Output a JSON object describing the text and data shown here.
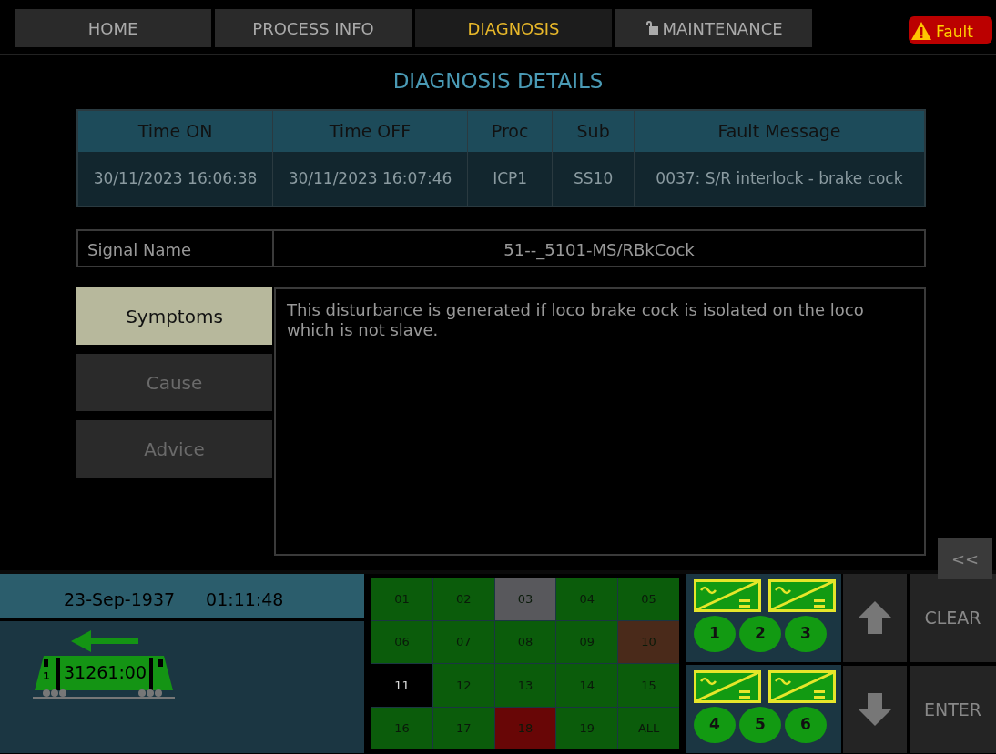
{
  "tabs": [
    {
      "label": "HOME",
      "selected": false,
      "kind": "plain"
    },
    {
      "label": "PROCESS INFO",
      "selected": false,
      "kind": "plain"
    },
    {
      "label": "DIAGNOSIS",
      "selected": true,
      "kind": "plain"
    },
    {
      "label": "MAINTENANCE",
      "selected": false,
      "kind": "locked"
    }
  ],
  "fault_badge": {
    "label": "Fault"
  },
  "title": "DIAGNOSIS DETAILS",
  "fault_table": {
    "columns": [
      "Time ON",
      "Time OFF",
      "Proc",
      "Sub",
      "Fault Message"
    ],
    "rows": [
      [
        "30/11/2023 16:06:38",
        "30/11/2023 16:07:46",
        "ICP1",
        "SS10",
        "0037: S/R interlock - brake cock"
      ]
    ]
  },
  "signal": {
    "label": "Signal Name",
    "value": "51--_5101-MS/RBkCock"
  },
  "detail_tabs": [
    {
      "label": "Symptoms",
      "selected": true
    },
    {
      "label": "Cause",
      "selected": false
    },
    {
      "label": "Advice",
      "selected": false
    }
  ],
  "detail_text": "This disturbance is generated if loco brake cock is isolated on the loco which is not slave.",
  "collapse_button": "<<",
  "status": {
    "date": "23-Sep-1937",
    "time": "01:11:48"
  },
  "loco": {
    "cab": "1",
    "number": "31261:00"
  },
  "units": [
    {
      "label": "01",
      "color": "#0b5c0b"
    },
    {
      "label": "02",
      "color": "#0b5c0b"
    },
    {
      "label": "03",
      "color": "#58585c"
    },
    {
      "label": "04",
      "color": "#0b5c0b"
    },
    {
      "label": "05",
      "color": "#0b5c0b"
    },
    {
      "label": "06",
      "color": "#0b5c0b"
    },
    {
      "label": "07",
      "color": "#0b5c0b"
    },
    {
      "label": "08",
      "color": "#0b5c0b"
    },
    {
      "label": "09",
      "color": "#0b5c0b"
    },
    {
      "label": "10",
      "color": "#4a2a1a"
    },
    {
      "label": "11",
      "color": "#000000"
    },
    {
      "label": "12",
      "color": "#0b5c0b"
    },
    {
      "label": "13",
      "color": "#0b5c0b"
    },
    {
      "label": "14",
      "color": "#0b5c0b"
    },
    {
      "label": "15",
      "color": "#0b5c0b"
    },
    {
      "label": "16",
      "color": "#0b5c0b"
    },
    {
      "label": "17",
      "color": "#0b5c0b"
    },
    {
      "label": "18",
      "color": "#680606"
    },
    {
      "label": "19",
      "color": "#0b5c0b"
    },
    {
      "label": "ALL",
      "color": "#0b5c0b"
    }
  ],
  "converter_groups": [
    {
      "units": [
        "1",
        "2",
        "3"
      ]
    },
    {
      "units": [
        "4",
        "5",
        "6"
      ]
    }
  ],
  "keys": [
    {
      "kind": "up",
      "label": "CLEAR"
    },
    {
      "kind": "down",
      "label": "ENTER"
    }
  ]
}
